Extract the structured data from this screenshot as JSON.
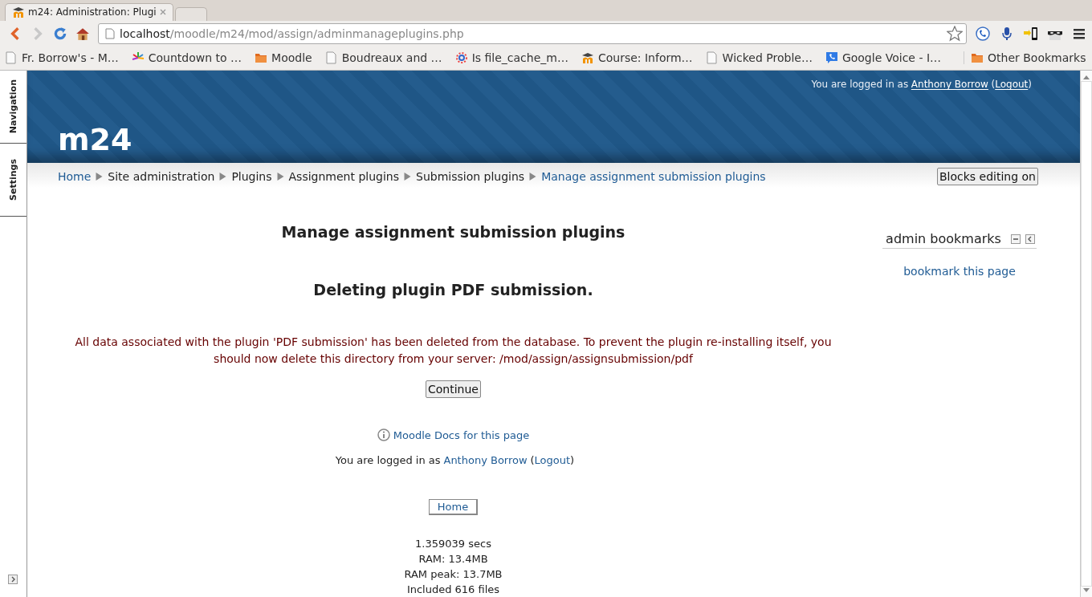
{
  "browser": {
    "tabs": [
      {
        "title": "m24: Administration: Plugi",
        "selected": true
      },
      {
        "selected": false
      }
    ],
    "address": {
      "host": "localhost",
      "path": "/moodle/m24/mod/assign/adminmanageplugins.php"
    },
    "bookmarks": [
      {
        "label": "Fr. Borrow's - M…",
        "kind": "page"
      },
      {
        "label": "Countdown to …",
        "kind": "burst"
      },
      {
        "label": "Moodle",
        "kind": "folder"
      },
      {
        "label": "Boudreaux and …",
        "kind": "page"
      },
      {
        "label": "Is file_cache_m…",
        "kind": "wheel"
      },
      {
        "label": "Course: Inform…",
        "kind": "moodle"
      },
      {
        "label": "Wicked Proble…",
        "kind": "page"
      },
      {
        "label": "Google Voice - I…",
        "kind": "phone"
      }
    ],
    "other_bookmarks": "Other Bookmarks"
  },
  "dock": [
    {
      "label": "Navigation"
    },
    {
      "label": "Settings"
    }
  ],
  "header": {
    "site_name": "m24",
    "login": [
      {
        "text": "You are logged in as",
        "link": false,
        "attached": false
      },
      {
        "text": "Anthony Borrow",
        "link": true,
        "attached": false
      },
      {
        "text": "(",
        "link": false,
        "attached": false
      },
      {
        "text": "Logout",
        "link": true,
        "attached": true
      },
      {
        "text": ")",
        "link": false,
        "attached": true
      }
    ]
  },
  "breadcrumb": [
    {
      "label": "Home",
      "link": true
    },
    {
      "label": "Site administration",
      "link": false
    },
    {
      "label": "Plugins",
      "link": false
    },
    {
      "label": "Assignment plugins",
      "link": false
    },
    {
      "label": "Submission plugins",
      "link": false
    },
    {
      "label": "Manage assignment submission plugins",
      "link": true
    }
  ],
  "blocks_button": "Blocks editing on",
  "main": {
    "heading": "Manage assignment submission plugins",
    "subheading": "Deleting plugin PDF submission.",
    "message": "All data associated with the plugin 'PDF submission' has been deleted from the database. To prevent the plugin re-installing itself, you should now delete this directory from your server: /mod/assign/assignsubmission/pdf",
    "continue": "Continue"
  },
  "block": {
    "title": "admin bookmarks",
    "link": "bookmark this page"
  },
  "footer": {
    "docs": "Moodle Docs for this page",
    "login": [
      {
        "text": "You are logged in as",
        "link": false,
        "attached": false
      },
      {
        "text": "Anthony Borrow",
        "link": true,
        "attached": false
      },
      {
        "text": "(",
        "link": false,
        "attached": false
      },
      {
        "text": "Logout",
        "link": true,
        "attached": true
      },
      {
        "text": ")",
        "link": false,
        "attached": true
      }
    ],
    "home": "Home",
    "stats": [
      "1.359039 secs",
      "RAM: 13.4MB",
      "RAM peak: 13.7MB",
      "Included 616 files"
    ]
  }
}
